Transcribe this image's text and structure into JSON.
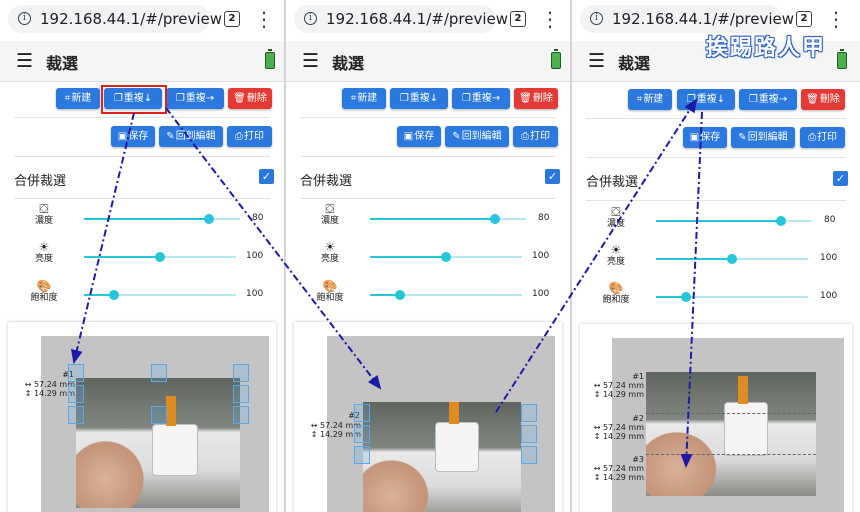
{
  "browser": {
    "url": "192.168.44.1/#/preview",
    "tab_count": "2"
  },
  "app": {
    "title": "裁選",
    "menu_icon": "menu-icon",
    "battery_icon": "battery-full-icon"
  },
  "toolbar": {
    "new_label": "新建",
    "dup_down_label": "重複",
    "dup_right_label": "重複",
    "delete_label": "刪除",
    "save_label": "保存",
    "back_label": "回到編輯",
    "print_label": "打印"
  },
  "merge": {
    "label": "合併裁選",
    "checked": true
  },
  "sliders": [
    {
      "icon": "paint-bucket-icon",
      "label": "濃度",
      "value": 80
    },
    {
      "icon": "brightness-icon",
      "label": "亮度",
      "value": 100
    },
    {
      "icon": "palette-icon",
      "label": "飽和度",
      "value": 100
    }
  ],
  "crop_labels": {
    "n1": "#1",
    "n2": "#2",
    "n3": "#3",
    "width": "↔ 57.24 mm",
    "height": "↕ 14.29 mm"
  },
  "watermark": "挨踢路人甲",
  "colors": {
    "primary": "#2b78de",
    "danger": "#e53935",
    "slider": "#26c6da",
    "highlight": "#e0201d",
    "annotation": "#1a1aa6"
  }
}
